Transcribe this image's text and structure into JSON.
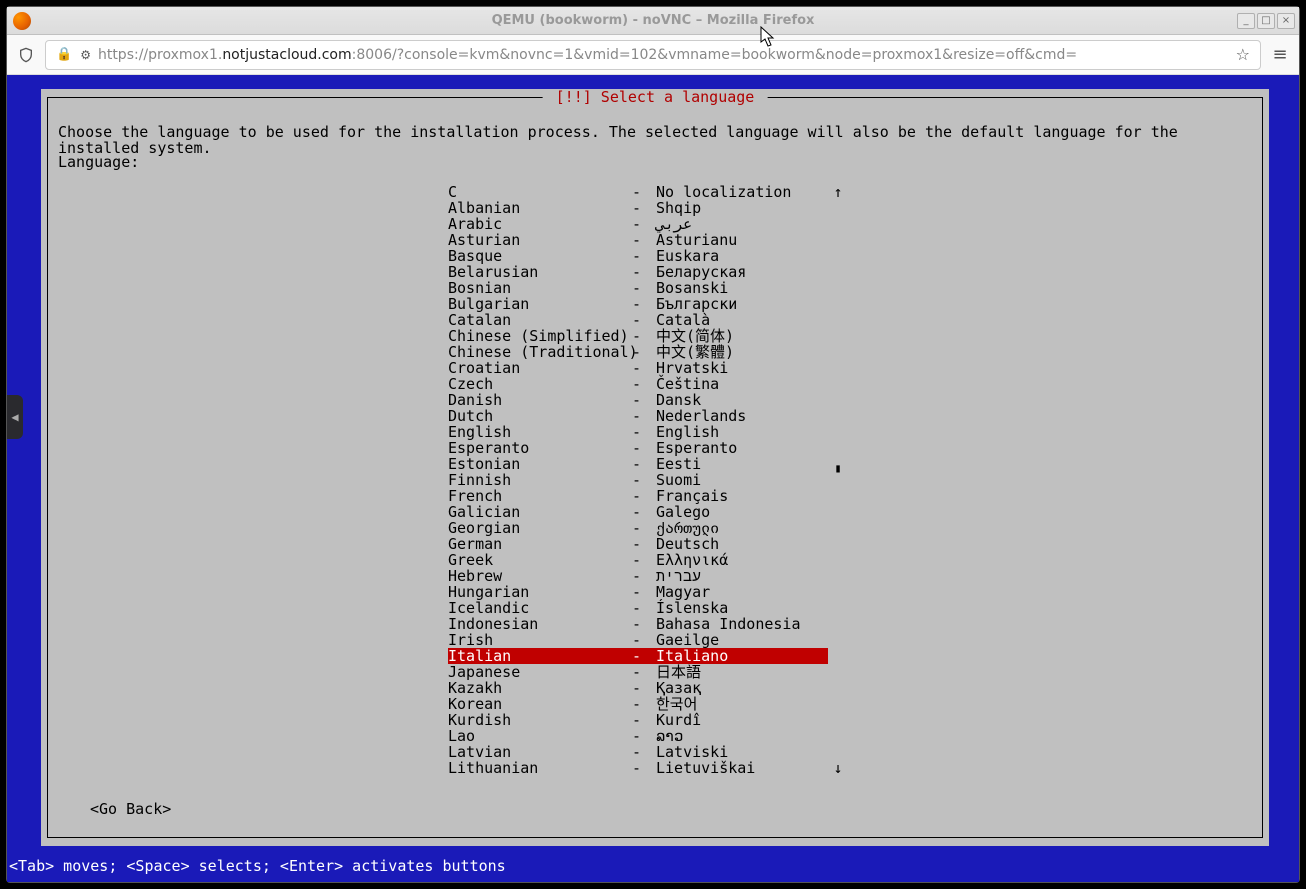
{
  "window": {
    "title": "QEMU (bookworm) - noVNC – Mozilla Firefox"
  },
  "addressbar": {
    "scheme": "https://",
    "sub": "proxmox1.",
    "domain": "notjustacloud.com",
    "port_path": ":8006/?console=kvm&novnc=1&vmid=102&vmname=bookworm&node=proxmox1&resize=off&cmd="
  },
  "installer": {
    "title": " [!!] Select a language ",
    "prompt": "Choose the language to be used for the installation process. The selected language will also be the default language for the installed system.",
    "label": "Language:",
    "goback": "<Go Back>",
    "selected_index": 29,
    "languages": [
      {
        "name": "C",
        "native": "No localization"
      },
      {
        "name": "Albanian",
        "native": "Shqip"
      },
      {
        "name": "Arabic",
        "native": "عربي"
      },
      {
        "name": "Asturian",
        "native": "Asturianu"
      },
      {
        "name": "Basque",
        "native": "Euskara"
      },
      {
        "name": "Belarusian",
        "native": "Беларуская"
      },
      {
        "name": "Bosnian",
        "native": "Bosanski"
      },
      {
        "name": "Bulgarian",
        "native": "Български"
      },
      {
        "name": "Catalan",
        "native": "Català"
      },
      {
        "name": "Chinese (Simplified)",
        "native": "中文(简体)"
      },
      {
        "name": "Chinese (Traditional)",
        "native": "中文(繁體)"
      },
      {
        "name": "Croatian",
        "native": "Hrvatski"
      },
      {
        "name": "Czech",
        "native": "Čeština"
      },
      {
        "name": "Danish",
        "native": "Dansk"
      },
      {
        "name": "Dutch",
        "native": "Nederlands"
      },
      {
        "name": "English",
        "native": "English"
      },
      {
        "name": "Esperanto",
        "native": "Esperanto"
      },
      {
        "name": "Estonian",
        "native": "Eesti"
      },
      {
        "name": "Finnish",
        "native": "Suomi"
      },
      {
        "name": "French",
        "native": "Français"
      },
      {
        "name": "Galician",
        "native": "Galego"
      },
      {
        "name": "Georgian",
        "native": "ქართული"
      },
      {
        "name": "German",
        "native": "Deutsch"
      },
      {
        "name": "Greek",
        "native": "Ελληνικά"
      },
      {
        "name": "Hebrew",
        "native": "עברית"
      },
      {
        "name": "Hungarian",
        "native": "Magyar"
      },
      {
        "name": "Icelandic",
        "native": "Íslenska"
      },
      {
        "name": "Indonesian",
        "native": "Bahasa Indonesia"
      },
      {
        "name": "Irish",
        "native": "Gaeilge"
      },
      {
        "name": "Italian",
        "native": "Italiano"
      },
      {
        "name": "Japanese",
        "native": "日本語"
      },
      {
        "name": "Kazakh",
        "native": "Қазақ"
      },
      {
        "name": "Korean",
        "native": "한국어"
      },
      {
        "name": "Kurdish",
        "native": "Kurdî"
      },
      {
        "name": "Lao",
        "native": "ລາວ"
      },
      {
        "name": "Latvian",
        "native": "Latviski"
      },
      {
        "name": "Lithuanian",
        "native": "Lietuviškai"
      }
    ]
  },
  "hints": "<Tab> moves; <Space> selects; <Enter> activates buttons"
}
